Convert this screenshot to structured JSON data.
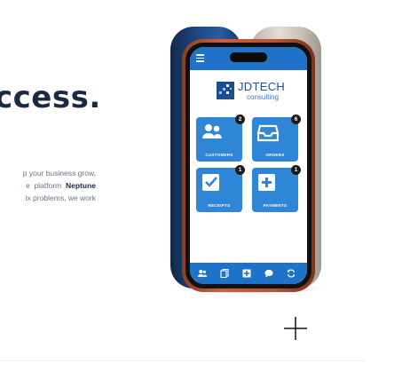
{
  "hero": {
    "headline": "ccess.",
    "para_line1": "p your business grow.",
    "para_line2_pre": "e  platform  ",
    "para_line2_bold": "Neptune",
    "para_line3": "ix problems, we work"
  },
  "app": {
    "brand": "JDTECH",
    "brand_sub": "consulting",
    "tiles": [
      {
        "label": "CUSTOMERS",
        "badge": "2",
        "icon": "users-icon"
      },
      {
        "label": "ORDERS",
        "badge": "6",
        "icon": "inbox-icon"
      },
      {
        "label": "RECEIPTS",
        "badge": "1",
        "icon": "checkbox-icon"
      },
      {
        "label": "PAYMENTS",
        "badge": "1",
        "icon": "plus-box-icon"
      }
    ],
    "bottom_nav": [
      "users-icon",
      "pages-icon",
      "add-icon",
      "chat-icon",
      "refresh-icon"
    ]
  },
  "colors": {
    "accent": "#1e73c8",
    "tile": "#2f86d6",
    "headline": "#1a2a44",
    "badge": "#1b1b1b"
  }
}
